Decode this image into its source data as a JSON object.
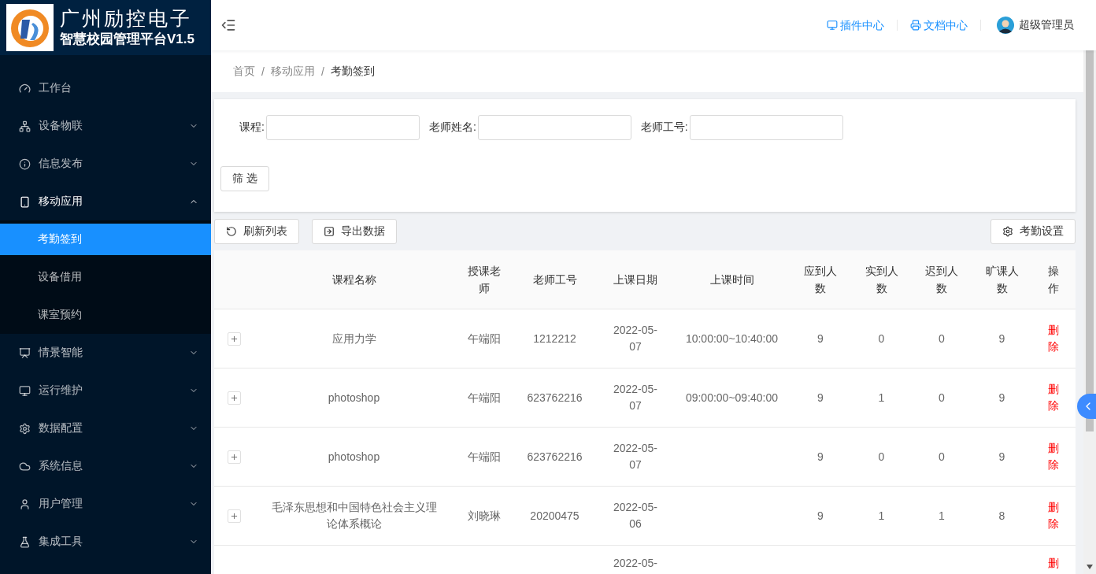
{
  "brand": {
    "title": "广州励控电子",
    "subtitle": "智慧校园管理平台V1.5"
  },
  "sidebar": {
    "items": [
      {
        "label": "工作台",
        "kind": "link"
      },
      {
        "label": "设备物联",
        "kind": "submenu",
        "expanded": false
      },
      {
        "label": "信息发布",
        "kind": "submenu",
        "expanded": false
      },
      {
        "label": "移动应用",
        "kind": "submenu",
        "expanded": true,
        "children": [
          {
            "label": "考勤签到",
            "selected": true
          },
          {
            "label": "设备借用",
            "selected": false
          },
          {
            "label": "课室预约",
            "selected": false
          }
        ]
      },
      {
        "label": "情景智能",
        "kind": "submenu",
        "expanded": false
      },
      {
        "label": "运行维护",
        "kind": "submenu",
        "expanded": false
      },
      {
        "label": "数据配置",
        "kind": "submenu",
        "expanded": false
      },
      {
        "label": "系统信息",
        "kind": "submenu",
        "expanded": false
      },
      {
        "label": "用户管理",
        "kind": "submenu",
        "expanded": false
      },
      {
        "label": "集成工具",
        "kind": "submenu",
        "expanded": false
      }
    ]
  },
  "header": {
    "links": [
      {
        "label": "插件中心"
      },
      {
        "label": "文档中心"
      }
    ],
    "user": "超级管理员"
  },
  "breadcrumb": {
    "separator": "/",
    "items": [
      "首页",
      "移动应用",
      "考勤签到"
    ]
  },
  "filters": {
    "fields": [
      {
        "label": "课程:"
      },
      {
        "label": "老师姓名:"
      },
      {
        "label": "老师工号:"
      }
    ],
    "button": "筛 选"
  },
  "toolbar": {
    "left": [
      {
        "label": "刷新列表"
      },
      {
        "label": "导出数据"
      }
    ],
    "right": {
      "label": "考勤设置"
    }
  },
  "table": {
    "columns": [
      "课程名称",
      "授课老师",
      "老师工号",
      "上课日期",
      "上课时间",
      "应到人数",
      "实到人数",
      "迟到人数",
      "旷课人数",
      "操作"
    ],
    "rows": [
      {
        "expand": true,
        "cells": [
          "应用力学",
          "午端阳",
          "1212212",
          "2022-05-07",
          "10:00:00~10:40:00",
          "9",
          "0",
          "0",
          "9"
        ],
        "action": "删除"
      },
      {
        "expand": true,
        "cells": [
          "photoshop",
          "午端阳",
          "623762216",
          "2022-05-07",
          "09:00:00~09:40:00",
          "9",
          "1",
          "0",
          "9"
        ],
        "action": "删除"
      },
      {
        "expand": true,
        "cells": [
          "photoshop",
          "午端阳",
          "623762216",
          "2022-05-07",
          null,
          "9",
          "0",
          "0",
          "9"
        ],
        "action": "删除"
      },
      {
        "expand": true,
        "cells": [
          "毛泽东思想和中国特色社会主义理论体系概论",
          "刘晓琳",
          "20200475",
          "2022-05-06",
          null,
          "9",
          "1",
          "1",
          "8"
        ],
        "action": "删除"
      },
      {
        "partial": true,
        "cells": [
          null,
          null,
          null,
          "2022-05-",
          null,
          null,
          null,
          null,
          null
        ],
        "action": "删"
      }
    ]
  }
}
